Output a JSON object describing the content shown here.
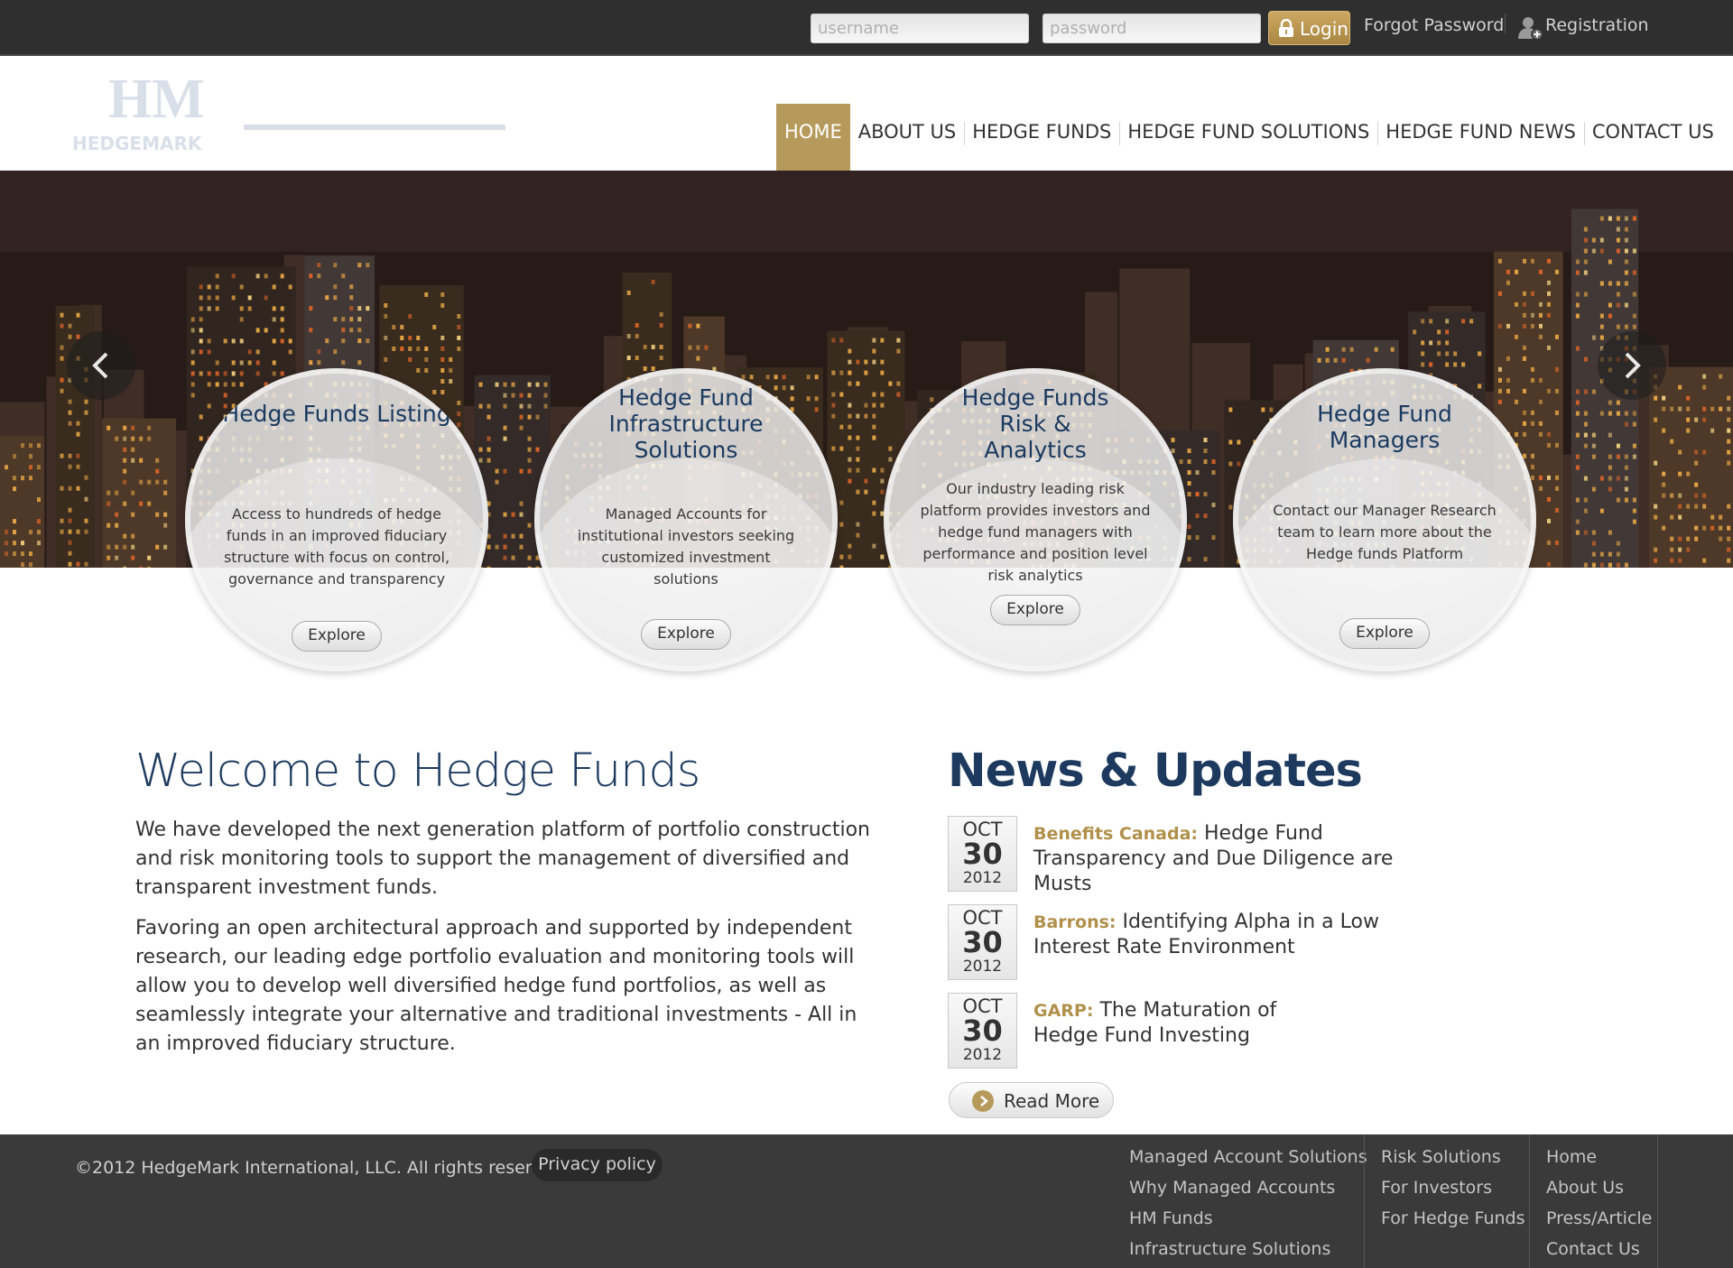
{
  "topbar": {
    "username_placeholder": "username",
    "password_placeholder": "password",
    "login_label": "Login",
    "forgot_label": "Forgot Password",
    "register_label": "Registration"
  },
  "nav": {
    "items": [
      {
        "label": "HOME",
        "active": true
      },
      {
        "label": "ABOUT US"
      },
      {
        "label": "HEDGE FUNDS"
      },
      {
        "label": "HEDGE FUND SOLUTIONS"
      },
      {
        "label": "HEDGE FUND NEWS"
      },
      {
        "label": "CONTACT US"
      }
    ]
  },
  "hero": {
    "circles": [
      {
        "title": "Hedge Funds Listing",
        "desc": "Access to hundreds of hedge funds in an improved fiduciary structure with focus on control, governance and transparency",
        "button": "Explore"
      },
      {
        "title": "Hedge Fund Infrastructure Solutions",
        "desc": "Managed Accounts for institutional investors seeking customized investment solutions",
        "button": "Explore"
      },
      {
        "title": "Hedge Funds Risk & Analytics",
        "desc": "Our industry leading risk platform provides investors and hedge fund managers with performance and position level risk analytics",
        "button": "Explore"
      },
      {
        "title": "Hedge Fund Managers",
        "desc": "Contact our Manager Research team to learn more about the Hedge funds Platform",
        "button": "Explore"
      }
    ]
  },
  "welcome": {
    "title": "Welcome to Hedge Funds",
    "paragraphs": [
      "We have developed the next generation platform of portfolio construction and risk monitoring tools to support the management of diversified and transparent investment funds.",
      "Favoring an open architectural approach and supported by independent research, our leading edge portfolio evaluation and monitoring tools will allow you to develop well diversified hedge fund portfolios, as well as seamlessly integrate your alternative and traditional investments - All in an improved fiduciary structure."
    ]
  },
  "news": {
    "title": "News & Updates",
    "items": [
      {
        "month": "OCT",
        "day": "30",
        "year": "2012",
        "source": "Benefits Canada:",
        "headline": "Hedge Fund Transparency and Due Diligence are Musts"
      },
      {
        "month": "OCT",
        "day": "30",
        "year": "2012",
        "source": "Barrons:",
        "headline": "Identifying Alpha in a Low Interest Rate Environment"
      },
      {
        "month": "OCT",
        "day": "30",
        "year": "2012",
        "source": "GARP:",
        "headline": "The Maturation of Hedge Fund Investing"
      }
    ],
    "read_more": "Read More"
  },
  "footer": {
    "copyright": "©2012 HedgeMark International, LLC. All rights reserved.",
    "privacy": "Privacy policy",
    "col1": [
      "Managed Account Solutions",
      "Why Managed Accounts",
      "HM Funds",
      "Infrastructure Solutions"
    ],
    "col2": [
      "Risk Solutions",
      "For Investors",
      "For Hedge Funds"
    ],
    "col3": [
      "Home",
      "About Us",
      "Press/Article",
      "Contact Us"
    ]
  },
  "colors": {
    "accent_gold": "#b69a5b",
    "heading_navy": "#1d3a5e",
    "topbar_bg": "#2f2f2f",
    "footer_bg": "#3a3a3a"
  }
}
